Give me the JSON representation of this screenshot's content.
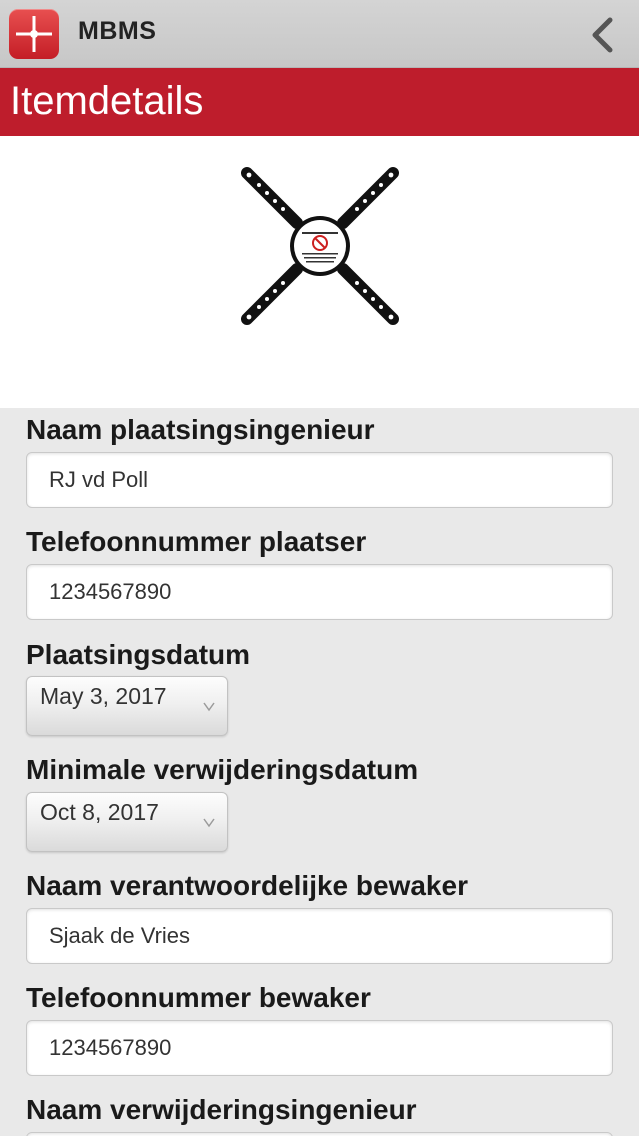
{
  "app": {
    "name": "MBMS",
    "logo_icon": "mbms-logo-icon",
    "back_icon": "back-chevron-icon",
    "brand_color": "#be1d2c"
  },
  "page": {
    "title": "Itemdetails"
  },
  "item_image": {
    "icon": "cross-mount-sign-icon"
  },
  "form": {
    "placement_engineer": {
      "label": "Naam plaatsingsingenieur",
      "value": "RJ vd Poll"
    },
    "placer_phone": {
      "label": "Telefoonnummer plaatser",
      "value": "1234567890"
    },
    "placement_date": {
      "label": "Plaatsingsdatum",
      "value": "May 3, 2017"
    },
    "min_removal_date": {
      "label": "Minimale verwijderingsdatum",
      "value": "Oct 8, 2017"
    },
    "guard_name": {
      "label": "Naam verantwoordelijke bewaker",
      "value": "Sjaak de Vries"
    },
    "guard_phone": {
      "label": "Telefoonnummer bewaker",
      "value": "1234567890"
    },
    "removal_engineer": {
      "label": "Naam verwijderingsingenieur",
      "value": ""
    }
  }
}
